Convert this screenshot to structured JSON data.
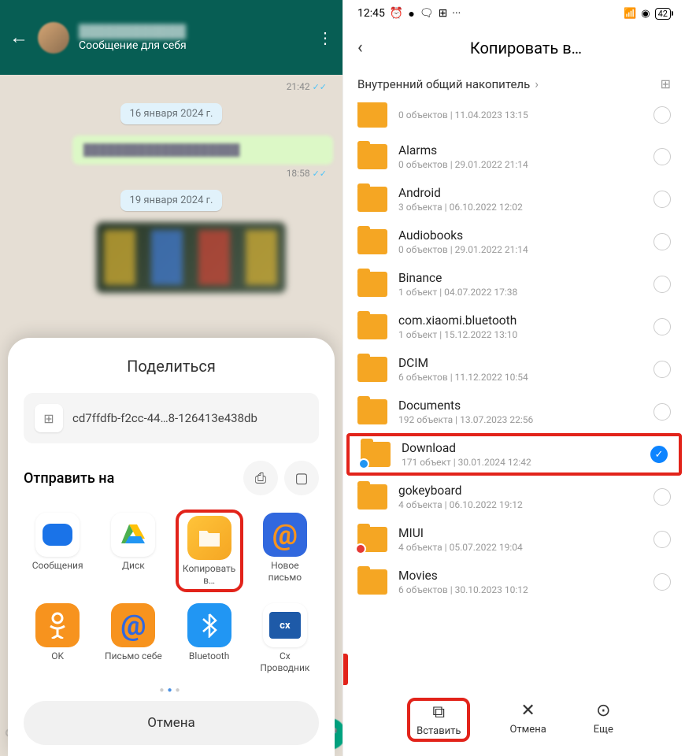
{
  "left": {
    "header_sub": "Сообщение для себя",
    "times": {
      "t1": "21:42",
      "t2": "18:58"
    },
    "date1": "16 января 2024 г.",
    "date2": "19 января 2024 г.",
    "share_title": "Поделиться",
    "file_name": "cd7ffdfb-f2cc-44…8-126413e438db",
    "send_label": "Отправить на",
    "apps": [
      {
        "label": "Сообщения"
      },
      {
        "label": "Диск"
      },
      {
        "label": "Копировать в…"
      },
      {
        "label": "Новое письмо"
      },
      {
        "label": "OK"
      },
      {
        "label": "Письмо себе"
      },
      {
        "label": "Bluetooth"
      },
      {
        "label": "Cx Проводник"
      }
    ],
    "cancel": "Отмена"
  },
  "right": {
    "status_time": "12:45",
    "battery": "42",
    "title": "Копировать в…",
    "breadcrumb": "Внутренний общий накопитель",
    "folders": [
      {
        "name": "",
        "meta": "0 объектов  |  11.04.2023 13:15"
      },
      {
        "name": "Alarms",
        "meta": "0 объектов  |  29.01.2022 21:14"
      },
      {
        "name": "Android",
        "meta": "3 объекта  |  06.10.2022 12:02"
      },
      {
        "name": "Audiobooks",
        "meta": "0 объектов  |  29.01.2022 21:14"
      },
      {
        "name": "Binance",
        "meta": "1 объект  |  04.07.2022 17:38"
      },
      {
        "name": "com.xiaomi.bluetooth",
        "meta": "1 объект  |  15.12.2022 13:10"
      },
      {
        "name": "DCIM",
        "meta": "6 объектов  |  11.12.2022 10:54"
      },
      {
        "name": "Documents",
        "meta": "192 объекта  |  13.07.2023 22:56"
      },
      {
        "name": "Download",
        "meta": "171 объект  |  30.01.2024 12:42"
      },
      {
        "name": "gokeyboard",
        "meta": "4 объекта  |  06.10.2022 19:12"
      },
      {
        "name": "MIUI",
        "meta": "4 объекта  |  05.07.2022 19:04"
      },
      {
        "name": "Movies",
        "meta": "6 объектов  |  30.10.2023 10:12"
      }
    ],
    "bottom": {
      "paste": "Вставить",
      "cancel": "Отмена",
      "more": "Еще"
    }
  }
}
